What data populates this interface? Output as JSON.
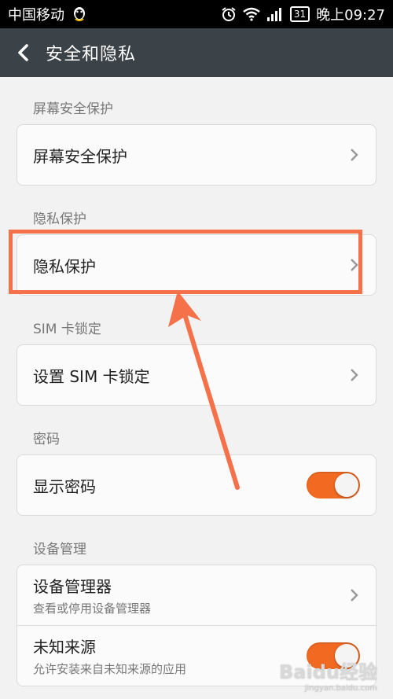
{
  "statusbar": {
    "carrier": "中国移动",
    "time": "晚上09:27",
    "battery": "31"
  },
  "appbar": {
    "title": "安全和隐私"
  },
  "sections": [
    {
      "label": "屏幕安全保护",
      "item": "屏幕安全保护"
    },
    {
      "label": "隐私保护",
      "item": "隐私保护"
    },
    {
      "label": "SIM 卡锁定",
      "item": "设置 SIM 卡锁定"
    },
    {
      "label": "密码",
      "item": "显示密码"
    },
    {
      "label": "设备管理"
    }
  ],
  "device_admin": {
    "title": "设备管理器",
    "subtitle": "查看或停用设备管理器"
  },
  "unknown_sources": {
    "title": "未知来源",
    "subtitle": "允许安装来自未知来源的应用"
  },
  "toggles": {
    "show_password": "on",
    "unknown_sources": "on"
  },
  "watermark": {
    "brand": "Baidu经验",
    "url": "jingyan.baidu.com"
  },
  "colors": {
    "accent": "#f26a21",
    "highlight": "#f4714a",
    "appbar": "#3c4348"
  }
}
